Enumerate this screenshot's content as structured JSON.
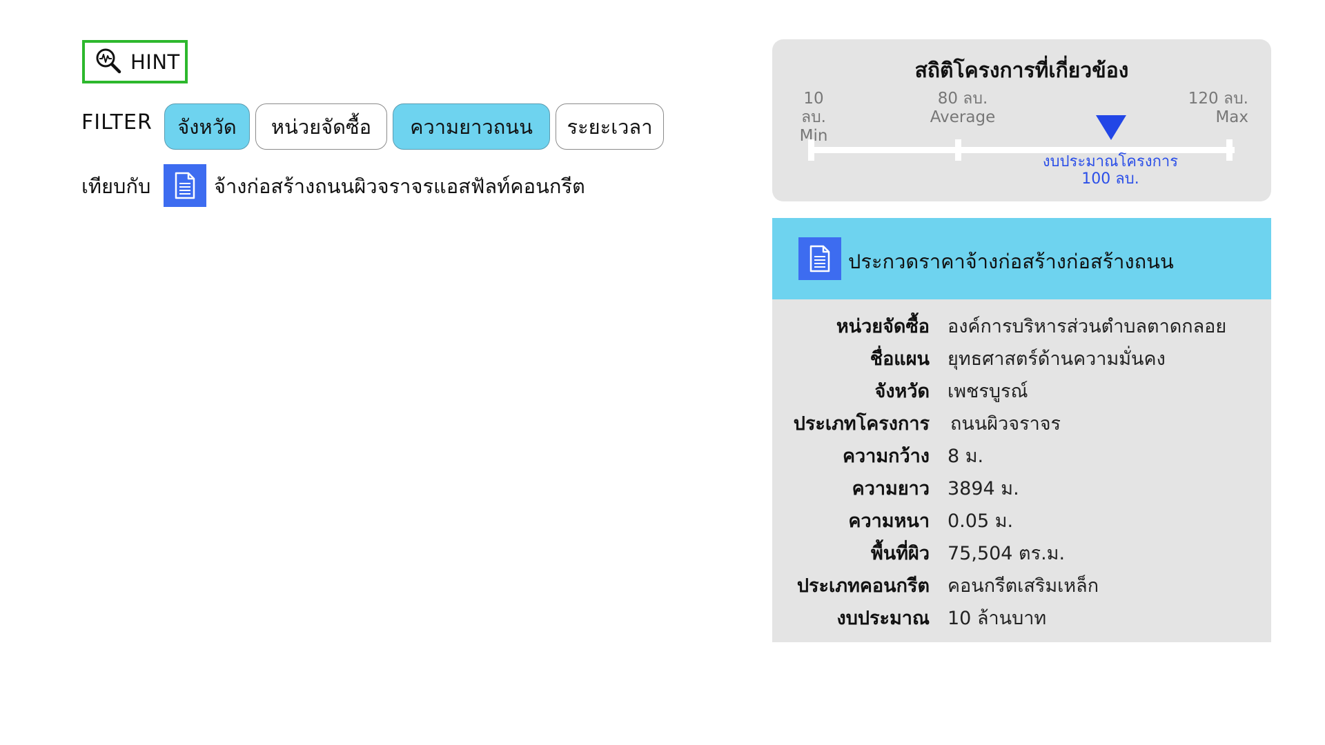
{
  "hint": {
    "label": "HINT",
    "icon": "magnifier-pulse-icon"
  },
  "filter": {
    "label": "FILTER",
    "chips": [
      {
        "label": "จังหวัด",
        "active": true
      },
      {
        "label": "หน่วยจัดซื้อ",
        "active": false
      },
      {
        "label": "ความยาวถนน",
        "active": true
      },
      {
        "label": "ระยะเวลา",
        "active": false
      }
    ]
  },
  "compare": {
    "label": "เทียบกับ",
    "icon": "document-icon",
    "project_name": "จ้างก่อสร้างถนนผิวจราจรแอสฟัลท์คอนกรีต"
  },
  "stats": {
    "title": "สถิติโครงการที่เกี่ยวข้อง",
    "min_value": "10 ลบ.",
    "min_label": "Min",
    "avg_value": "80 ลบ.",
    "avg_label": "Average",
    "max_value": "120 ลบ.",
    "max_label": "Max",
    "marker_label": "งบประมาณโครงการ",
    "marker_value": "100 ลบ.",
    "marker_color": "#2246e6"
  },
  "detail": {
    "icon": "document-icon",
    "title": "ประกวดราคาจ้างก่อสร้างก่อสร้างถนน",
    "rows": [
      {
        "label": "หน่วยจัดซื้อ",
        "value": "องค์การบริหารส่วนตำบลตาดกลอย"
      },
      {
        "label": "ชื่อแผน",
        "value": "ยุทธศาสตร์ด้านความมั่นคง"
      },
      {
        "label": "จังหวัด",
        "value": "เพชรบูรณ์"
      },
      {
        "label": "ประเภทโครงการ",
        "value": "ถนนผิวจราจร"
      },
      {
        "label": "ความกว้าง",
        "value": "8 ม."
      },
      {
        "label": "ความยาว",
        "value": "3894 ม."
      },
      {
        "label": "ความหนา",
        "value": "0.05 ม."
      },
      {
        "label": "พื้นที่ผิว",
        "value": "75,504 ตร.ม."
      },
      {
        "label": "ประเภทคอนกรีต",
        "value": "คอนกรีตเสริมเหล็ก"
      },
      {
        "label": "งบประมาณ",
        "value": "10 ล้านบาท"
      }
    ]
  },
  "colors": {
    "accent_chip": "#6ed3ef",
    "icon_blue": "#3d6cf0",
    "hint_border": "#2db82d",
    "card_bg": "#e4e4e4"
  }
}
